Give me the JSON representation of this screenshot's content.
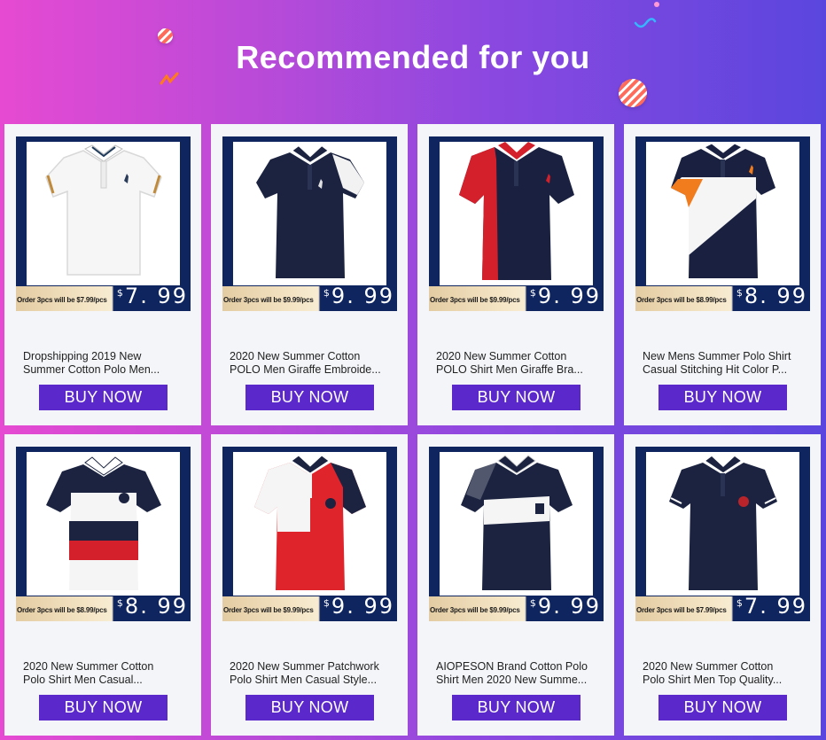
{
  "header": {
    "title": "Recommended for you"
  },
  "theme": {
    "button_color": "#5b28cc",
    "frame_color": "#0f2560",
    "card_bg": "#f3f5f8"
  },
  "products": [
    {
      "promo": "Order 3pcs will be $7.99/pcs",
      "currency": "$",
      "price": "7. 99",
      "name_line1": "Dropshipping 2019 New",
      "name_line2": "Summer Cotton Polo Men...",
      "button": "BUY NOW",
      "image": "white-polo-giraffe"
    },
    {
      "promo": "Order 3pcs will be $9.99/pcs",
      "currency": "$",
      "price": "9. 99",
      "name_line1": "2020 New Summer Cotton",
      "name_line2": "POLO Men Giraffe Embroide...",
      "button": "BUY NOW",
      "image": "navy-polo-white-sleeve"
    },
    {
      "promo": "Order 3pcs will be $9.99/pcs",
      "currency": "$",
      "price": "9. 99",
      "name_line1": "2020 New Summer Cotton",
      "name_line2": "POLO Shirt Men Giraffe Bra...",
      "button": "BUY NOW",
      "image": "navy-red-polo"
    },
    {
      "promo": "Order 3pcs will be $8.99/pcs",
      "currency": "$",
      "price": "8. 99",
      "name_line1": "New Mens Summer Polo Shirt",
      "name_line2": "Casual Stitching Hit Color P...",
      "button": "BUY NOW",
      "image": "orange-white-navy-polo"
    },
    {
      "promo": "Order 3pcs will be $8.99/pcs",
      "currency": "$",
      "price": "8. 99",
      "name_line1": "2020 New Summer Cotton",
      "name_line2": "Polo Shirt Men Casual...",
      "button": "BUY NOW",
      "image": "striped-navy-red-polo"
    },
    {
      "promo": "Order 3pcs will be $9.99/pcs",
      "currency": "$",
      "price": "9. 99",
      "name_line1": "2020 New Summer Patchwork",
      "name_line2": "Polo Shirt Men Casual Style...",
      "button": "BUY NOW",
      "image": "red-white-patchwork-polo"
    },
    {
      "promo": "Order 3pcs will be $9.99/pcs",
      "currency": "$",
      "price": "9. 99",
      "name_line1": "AIOPESON Brand Cotton Polo",
      "name_line2": "Shirt Men 2020 New Summe...",
      "button": "BUY NOW",
      "image": "navy-white-band-polo"
    },
    {
      "promo": "Order 3pcs will be $7.99/pcs",
      "currency": "$",
      "price": "7. 99",
      "name_line1": "2020 New Summer Cotton",
      "name_line2": "Polo Shirt Men Top Quality...",
      "button": "BUY NOW",
      "image": "navy-polo-emblem"
    }
  ]
}
